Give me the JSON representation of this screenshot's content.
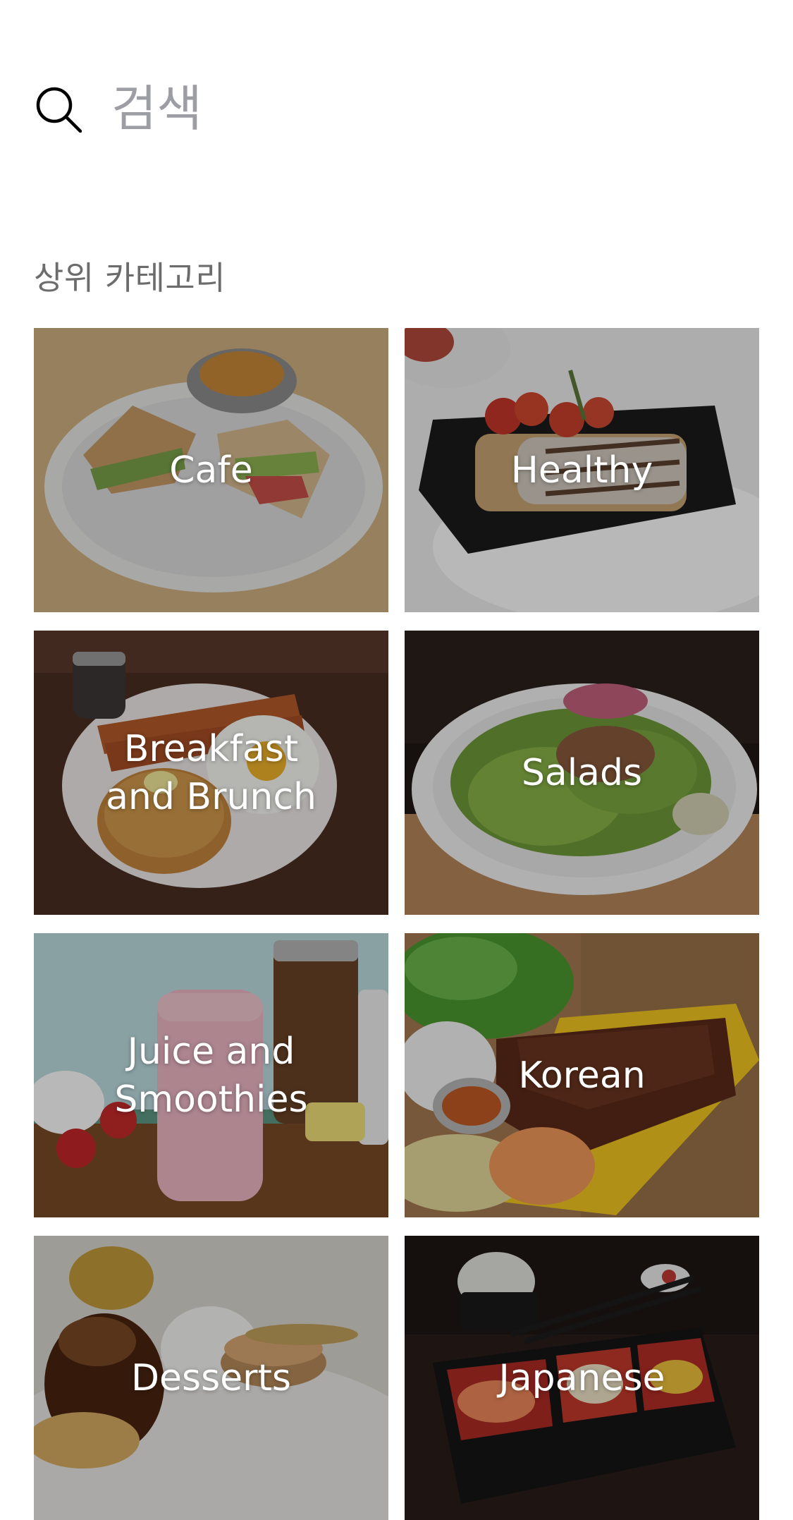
{
  "search": {
    "placeholder": "검색",
    "icon": "search-icon"
  },
  "section": {
    "title": "상위 카테고리"
  },
  "categories": [
    {
      "label": "Cafe"
    },
    {
      "label": "Healthy"
    },
    {
      "label": "Breakfast\nand Brunch"
    },
    {
      "label": "Salads"
    },
    {
      "label": "Juice and\nSmoothies"
    },
    {
      "label": "Korean"
    },
    {
      "label": "Desserts"
    },
    {
      "label": "Japanese"
    }
  ]
}
